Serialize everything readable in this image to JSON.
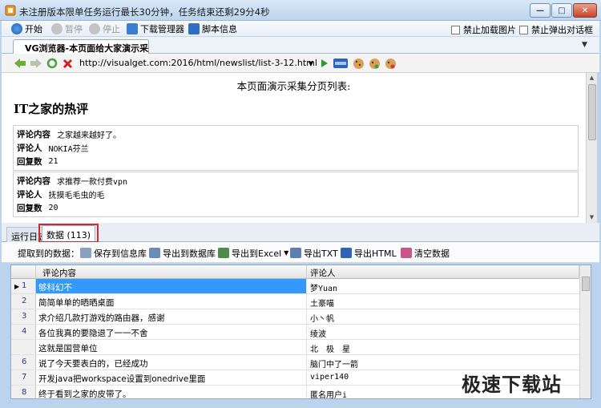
{
  "window": {
    "title": "未注册版本限单任务运行最长30分钟，任务结束还剩29分4秒",
    "min": "—",
    "max": "□",
    "close": "✕"
  },
  "toolbar": {
    "start": "开始",
    "pause": "暂停",
    "stop": "停止",
    "download_manager": "下载管理器",
    "script_info": "脚本信息",
    "block_images": "禁止加载图片",
    "block_dialogs": "禁止弹出对话框"
  },
  "browser_tab": {
    "title": "VG浏览器-本页面给大家演示采...",
    "dropdown": "▼"
  },
  "nav": {
    "url": "http://visualget.com:2016/html/newslist/list-3-12.html",
    "url_dropdown": "▼"
  },
  "page": {
    "heading": "本页面演示采集分页列表:",
    "section_title": "IT之家的热评",
    "cards": [
      {
        "k1": "评论内容",
        "v1": "之家越来越好了。",
        "k2": "评论人",
        "v2": "NOKIA芬兰",
        "k3": "回复数",
        "v3": "21"
      },
      {
        "k1": "评论内容",
        "v1": "求推荐一款付费vpn",
        "k2": "评论人",
        "v2": "抚摸毛毛虫的毛",
        "k3": "回复数",
        "v3": "20"
      }
    ]
  },
  "panel_tabs": {
    "log": "运行日志",
    "data": "数据 (113)"
  },
  "data_toolbar": {
    "label": "提取到的数据：",
    "save_info": "保存到信息库",
    "export_db": "导出到数据库",
    "export_excel": "导出到Excel",
    "export_txt": "导出TXT",
    "export_html": "导出HTML",
    "clear": "清空数据"
  },
  "table": {
    "columns": [
      "评论内容",
      "评论人"
    ],
    "rows": [
      {
        "n": "1",
        "content": "够科幻不",
        "author": "梦Yuan"
      },
      {
        "n": "2",
        "content": "简简单单的晒晒桌面",
        "author": "土豪喵"
      },
      {
        "n": "3",
        "content": "求介绍几款打游戏的路由器，感谢",
        "author": "小丶帆"
      },
      {
        "n": "4",
        "content": "各位我真的要隐退了一一不舍",
        "author": "绫波"
      },
      {
        "n": "",
        "content": "这就是国营单位",
        "author": "北　极　星"
      },
      {
        "n": "6",
        "content": "说了今天要表白的，已经成功",
        "author": "脑门中了一箭"
      },
      {
        "n": "7",
        "content": "开发java把workspace设置到onedrive里面",
        "author": "viper140"
      },
      {
        "n": "8",
        "content": "终于看到之家的皮带了。",
        "author": "匿名用户i"
      }
    ]
  },
  "watermark": "极速下载站",
  "colors": {
    "accent": "#3399ff",
    "highlight_box": "#d22a2a",
    "titlebar": "#bcd4ef"
  }
}
